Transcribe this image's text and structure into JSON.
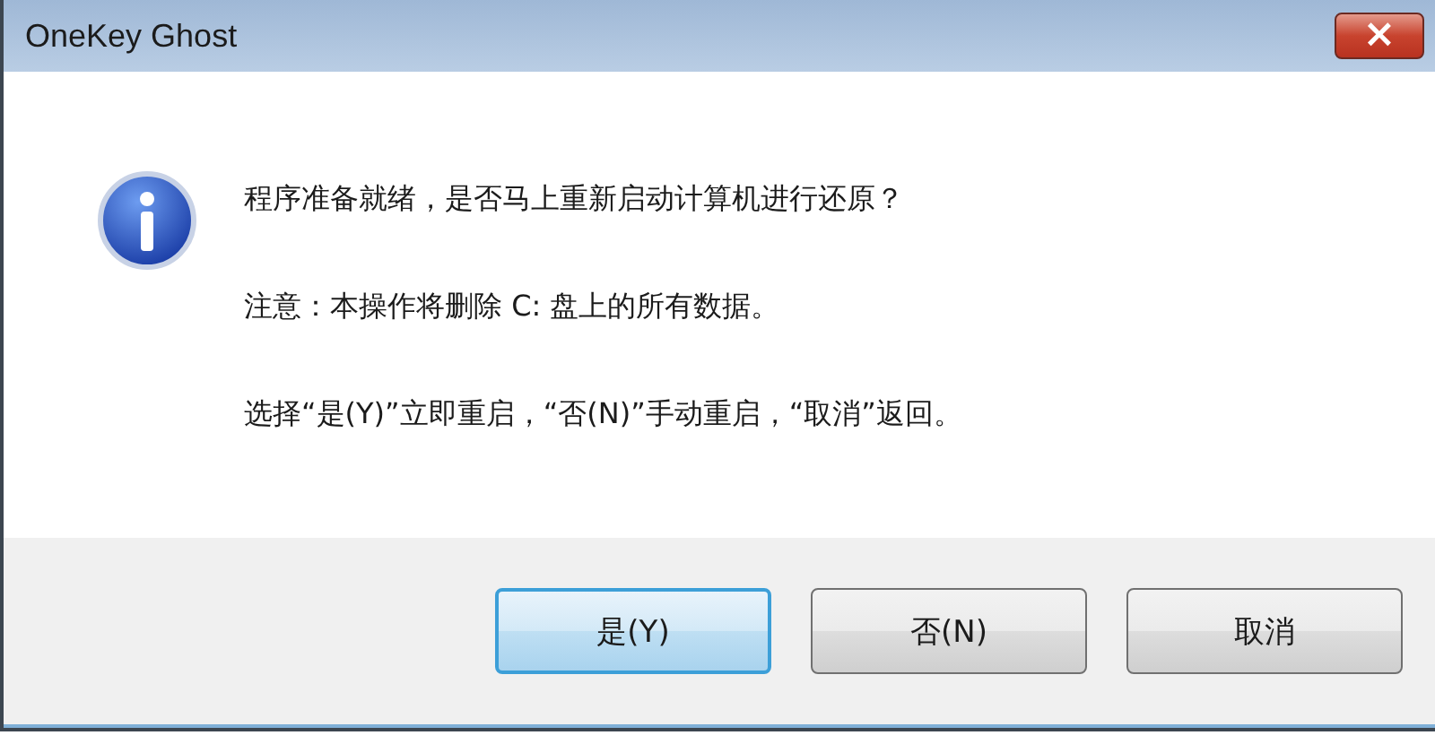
{
  "window": {
    "title": "OneKey Ghost",
    "close": "×"
  },
  "message": {
    "kind": "info",
    "lines": [
      "程序准备就绪，是否马上重新启动计算机进行还原？",
      "注意：本操作将删除 C: 盘上的所有数据。",
      "选择“是(Y)”立即重启，“否(N)”手动重启，“取消”返回。"
    ]
  },
  "buttons": [
    {
      "label": "是(Y)",
      "default": true
    },
    {
      "label": "否(N)",
      "default": false
    },
    {
      "label": "取消",
      "default": false
    }
  ]
}
